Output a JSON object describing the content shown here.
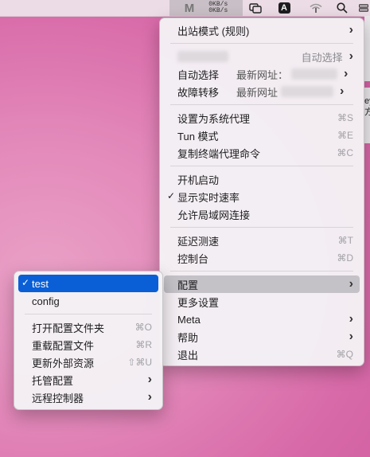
{
  "menubar": {
    "upload_speed": "0KB/s",
    "download_speed": "0KB/s",
    "app_letter": "A",
    "app_icon": "clash-m-icon"
  },
  "main_menu": {
    "outbound_mode": "出站模式 (规则)",
    "auto_select_group": "自动选择",
    "auto_select": "自动选择",
    "failover": "故障转移",
    "latest_url_1": "最新网址：",
    "latest_url_2": "最新网址",
    "set_system_proxy": "设置为系统代理",
    "set_system_proxy_sc": "⌘S",
    "tun_mode": "Tun 模式",
    "tun_mode_sc": "⌘E",
    "copy_terminal_cmd": "复制终端代理命令",
    "copy_terminal_cmd_sc": "⌘C",
    "launch_at_login": "开机启动",
    "show_speed": "显示实时速率",
    "allow_lan": "允许局域网连接",
    "latency_test": "延迟测速",
    "latency_test_sc": "⌘T",
    "dashboard": "控制台",
    "dashboard_sc": "⌘D",
    "config": "配置",
    "more_settings": "更多设置",
    "meta": "Meta",
    "help": "帮助",
    "quit": "退出",
    "quit_sc": "⌘Q"
  },
  "config_submenu": {
    "profile_test": "test",
    "profile_config": "config",
    "open_folder": "打开配置文件夹",
    "open_folder_sc": "⌘O",
    "reload": "重载配置文件",
    "reload_sc": "⌘R",
    "update_external": "更新外部资源",
    "update_external_sc": "⇧⌘U",
    "managed": "托管配置",
    "remote_controller": "远程控制器"
  },
  "edge_text": "ey\n方手"
}
